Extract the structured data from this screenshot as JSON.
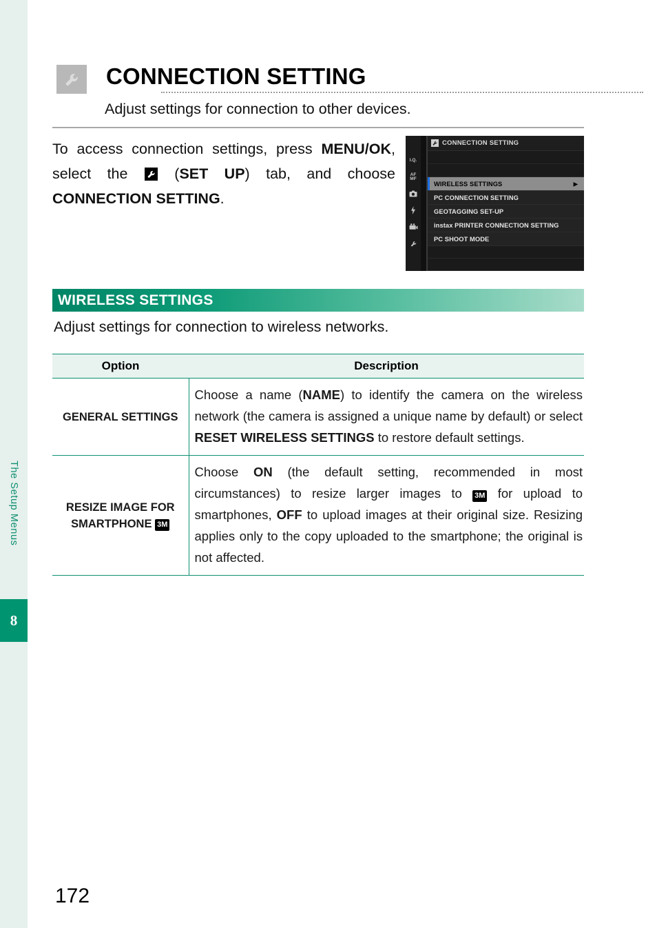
{
  "sidebar": {
    "chapter_label": "The Setup Menus",
    "chapter_number": "8",
    "accent_color": "#009470",
    "strip_color": "#e6f0ec"
  },
  "header": {
    "icon": "wrench-icon",
    "title": "CONNECTION SETTING",
    "subtitle": "Adjust settings for connection to other devices."
  },
  "intro": {
    "part1": "To access connection settings, press ",
    "bold1": "MENU/OK",
    "part2": ", select the ",
    "icon": "wrench-icon",
    "part3": " (",
    "bold2": "SET UP",
    "part4": ") tab, and choose ",
    "bold3": "CONNECTION SETTING",
    "part5": "."
  },
  "camera_screen": {
    "header_icon": "wrench-icon",
    "header_title": "CONNECTION SETTING",
    "tabs": [
      "I.Q.",
      "AF/MF",
      "camera-icon",
      "flash-icon",
      "movie-icon",
      "wrench-icon"
    ],
    "tab_labels": {
      "iq": "I.Q.",
      "af": "AF",
      "mf": "MF"
    },
    "menu_items": [
      {
        "label": "WIRELESS SETTINGS",
        "selected": true,
        "has_arrow": true
      },
      {
        "label": "PC CONNECTION SETTING",
        "selected": false,
        "has_arrow": false
      },
      {
        "label": "GEOTAGGING SET-UP",
        "selected": false,
        "has_arrow": false
      },
      {
        "label": "instax PRINTER CONNECTION SETTING",
        "selected": false,
        "has_arrow": false
      },
      {
        "label": "PC SHOOT MODE",
        "selected": false,
        "has_arrow": false
      }
    ],
    "selection_bar_color": "#1e6ee0",
    "selected_row_color": "#8d8d8d",
    "arrow_glyph": "▶"
  },
  "section": {
    "bar_title": "WIRELESS SETTINGS",
    "description": "Adjust settings for connection to wireless networks.",
    "gradient_from": "#008566",
    "gradient_to": "#a8dcca"
  },
  "table": {
    "headers": {
      "option": "Option",
      "description": "Description"
    },
    "rows": [
      {
        "option": "GENERAL SETTINGS",
        "option_badge": "",
        "desc_part1": "Choose a name (",
        "desc_bold1": "NAME",
        "desc_part2": ") to identify the camera on the wireless network (the camera is assigned a unique name by default) or select ",
        "desc_bold2": "RESET WIRELESS SETTINGS",
        "desc_part3": " to restore default settings."
      },
      {
        "option_line1": "RESIZE IMAGE FOR",
        "option_line2": "SMARTPHONE",
        "option_badge": "3M",
        "desc_part1": "Choose ",
        "desc_bold1": "ON",
        "desc_part2": " (the default setting, recommended in most circumstances) to resize larger images to ",
        "desc_badge": "3M",
        "desc_part3": " for upload to smartphones, ",
        "desc_bold2": "OFF",
        "desc_part4": " to upload images at their original size. Resizing applies only to the copy uploaded to the smartphone; the original is not affected."
      }
    ]
  },
  "footer": {
    "page_number": "172"
  }
}
